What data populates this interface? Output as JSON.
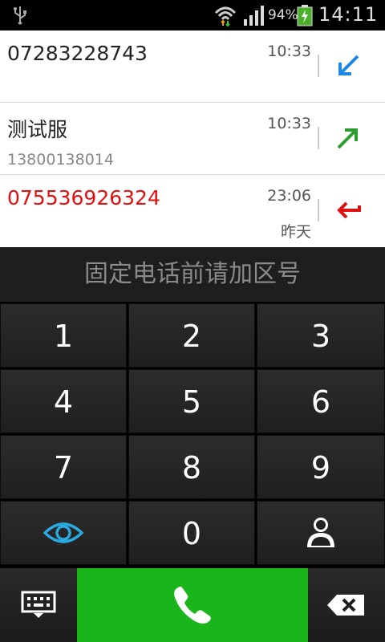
{
  "status_bar": {
    "battery_percent": "94%",
    "time": "14:11",
    "icons": [
      "usb-icon",
      "wifi-icon",
      "signal-icon",
      "battery-charging-icon"
    ]
  },
  "call_log": [
    {
      "number": "07283228743",
      "name": "",
      "time": "10:33",
      "date": "",
      "type": "incoming",
      "number_color": "#222222",
      "arrow_color": "#1e88e5"
    },
    {
      "number": "测试服",
      "name": "13800138014",
      "time": "10:33",
      "date": "",
      "type": "outgoing",
      "number_color": "#222222",
      "arrow_color": "#2e9d2e"
    },
    {
      "number": "075536926324",
      "name": "",
      "time": "23:06",
      "date": "昨天",
      "type": "missed",
      "number_color": "#e01010",
      "arrow_color": "#e01010"
    }
  ],
  "hint": "固定电话前请加区号",
  "keypad": {
    "keys": [
      "1",
      "2",
      "3",
      "4",
      "5",
      "6",
      "7",
      "8",
      "9",
      "0"
    ],
    "icons": [
      "eye-icon",
      "contact-icon",
      "keyboard-icon",
      "phone-icon",
      "backspace-icon"
    ]
  },
  "colors": {
    "call_button": "#1ab51a",
    "eye_icon": "#2aa9e0"
  }
}
